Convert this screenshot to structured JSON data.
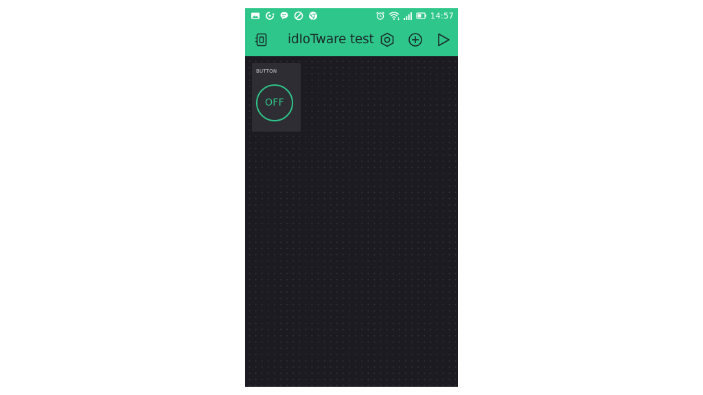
{
  "status_bar": {
    "notification_icons": [
      "image-icon",
      "sync-icon",
      "chat-icon",
      "no-sign-icon",
      "chrome-icon"
    ],
    "system_icons": [
      "alarm-icon",
      "wifi-icon",
      "signal-icon",
      "battery-icon"
    ],
    "time": "14:57"
  },
  "toolbar": {
    "title": "idIoTware test",
    "left_icon": "device-icon",
    "right_icons": [
      "settings-hexagon-icon",
      "add-widget-icon",
      "play-icon"
    ]
  },
  "widget": {
    "label": "BUTTON",
    "state": "OFF"
  },
  "colors": {
    "accent": "#2ec68a",
    "canvas": "#1c1b21",
    "widget_bg": "#2e2d33"
  }
}
